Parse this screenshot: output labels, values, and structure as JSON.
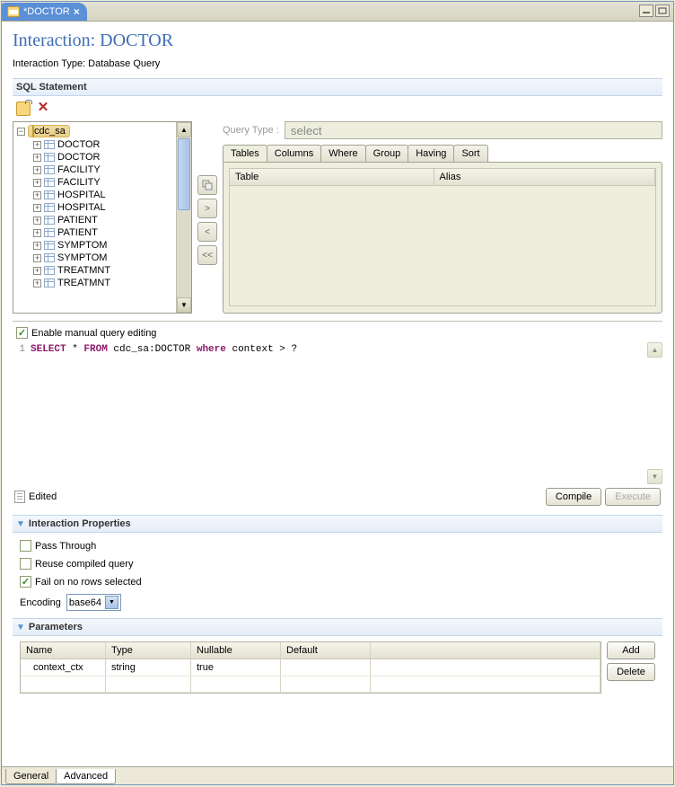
{
  "tab": {
    "title": "*DOCTOR"
  },
  "header": {
    "title": "Interaction: DOCTOR",
    "subtitle": "Interaction Type: Database Query"
  },
  "sql_section": {
    "title": "SQL Statement"
  },
  "tree": {
    "root": "cdc_sa",
    "items": [
      "DOCTOR",
      "DOCTOR",
      "FACILITY",
      "FACILITY",
      "HOSPITAL",
      "HOSPITAL",
      "PATIENT",
      "PATIENT",
      "SYMPTOM",
      "SYMPTOM",
      "TREATMNT",
      "TREATMNT"
    ]
  },
  "query": {
    "type_label": "Query Type :",
    "type_value": "select",
    "tabs": [
      "Tables",
      "Columns",
      "Where",
      "Group",
      "Having",
      "Sort"
    ],
    "table_headers": {
      "table": "Table",
      "alias": "Alias"
    }
  },
  "editor": {
    "enable_label": "Enable manual query editing",
    "line1_kw1": "SELECT",
    "line1_kw2": "FROM",
    "line1_mid": " * ",
    "line1_tbl": " cdc_sa:DOCTOR ",
    "line1_kw3": "where",
    "line1_rest": " context > ?",
    "status": "Edited",
    "compile": "Compile",
    "execute": "Execute"
  },
  "props": {
    "title": "Interaction Properties",
    "pass_through": "Pass Through",
    "reuse": "Reuse compiled query",
    "fail": "Fail on no rows selected",
    "encoding_label": "Encoding",
    "encoding_value": "base64"
  },
  "params": {
    "title": "Parameters",
    "headers": {
      "name": "Name",
      "type": "Type",
      "nullable": "Nullable",
      "default": "Default"
    },
    "row": {
      "name": "context_ctx",
      "type": "string",
      "nullable": "true",
      "default": ""
    },
    "add": "Add",
    "delete": "Delete"
  },
  "bottom_tabs": {
    "general": "General",
    "advanced": "Advanced"
  }
}
